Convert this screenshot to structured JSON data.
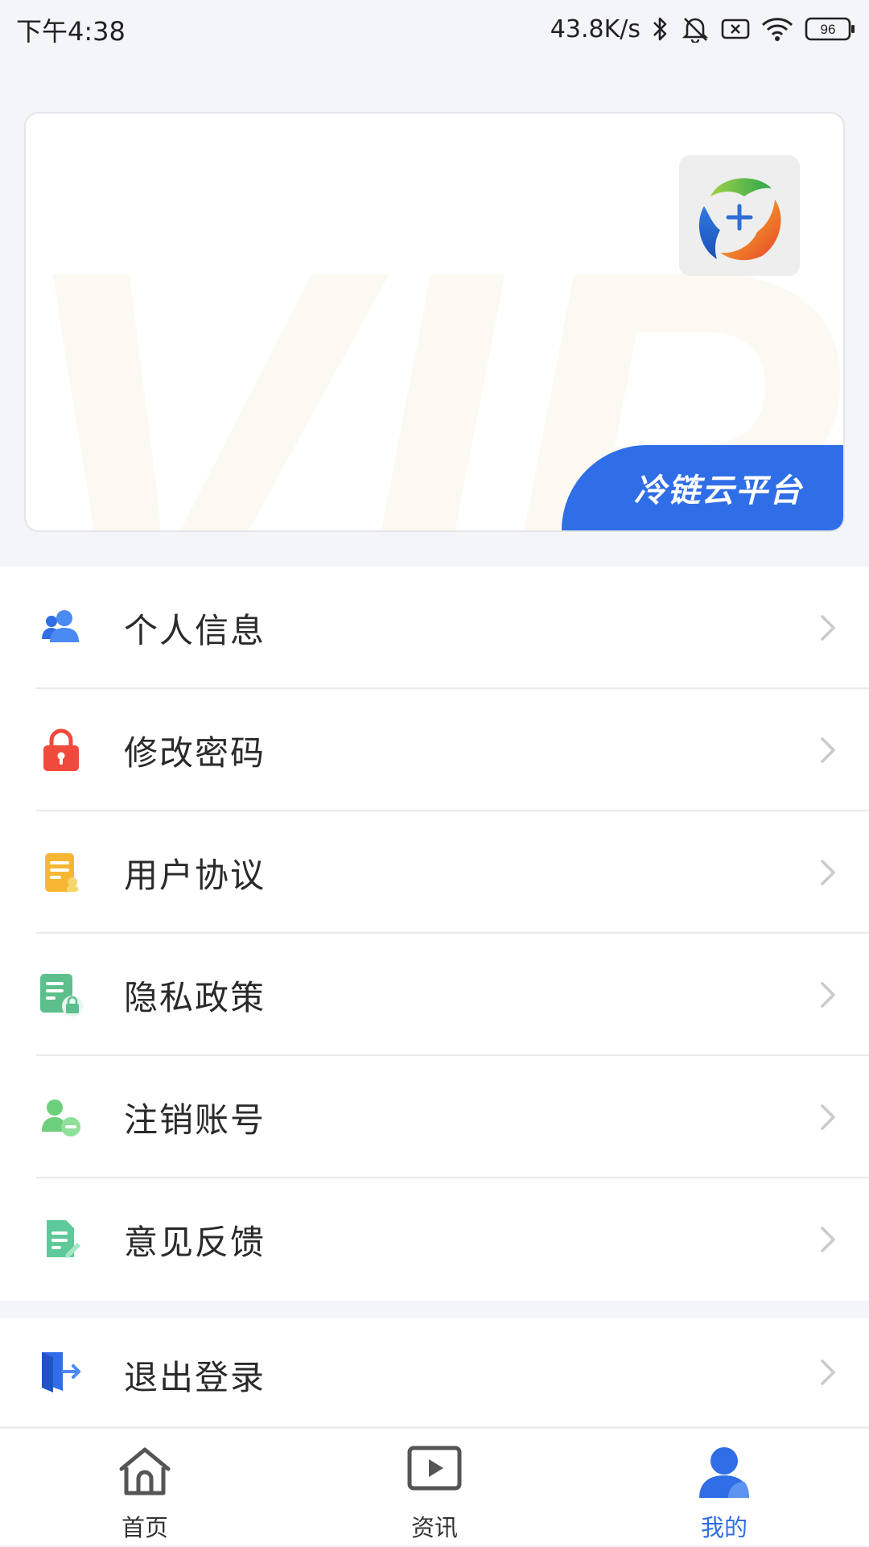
{
  "status_bar": {
    "time": "下午4:38",
    "net_speed": "43.8K/s",
    "battery": "96"
  },
  "vip_card": {
    "watermark": "VIP",
    "brand": "冷链云平台"
  },
  "menu": {
    "items": [
      {
        "label": "个人信息",
        "icon": "user-group-icon"
      },
      {
        "label": "修改密码",
        "icon": "lock-icon"
      },
      {
        "label": "用户协议",
        "icon": "agreement-icon"
      },
      {
        "label": "隐私政策",
        "icon": "privacy-policy-icon"
      },
      {
        "label": "注销账号",
        "icon": "cancel-account-icon"
      },
      {
        "label": "意见反馈",
        "icon": "feedback-icon"
      }
    ],
    "logout": {
      "label": "退出登录",
      "icon": "logout-icon"
    }
  },
  "tabbar": {
    "tabs": [
      {
        "label": "首页",
        "icon": "home-icon"
      },
      {
        "label": "资讯",
        "icon": "video-icon"
      },
      {
        "label": "我的",
        "icon": "profile-icon"
      }
    ],
    "active": "我的"
  },
  "colors": {
    "accent": "#2f6ee6",
    "background": "#f4f5f9"
  }
}
